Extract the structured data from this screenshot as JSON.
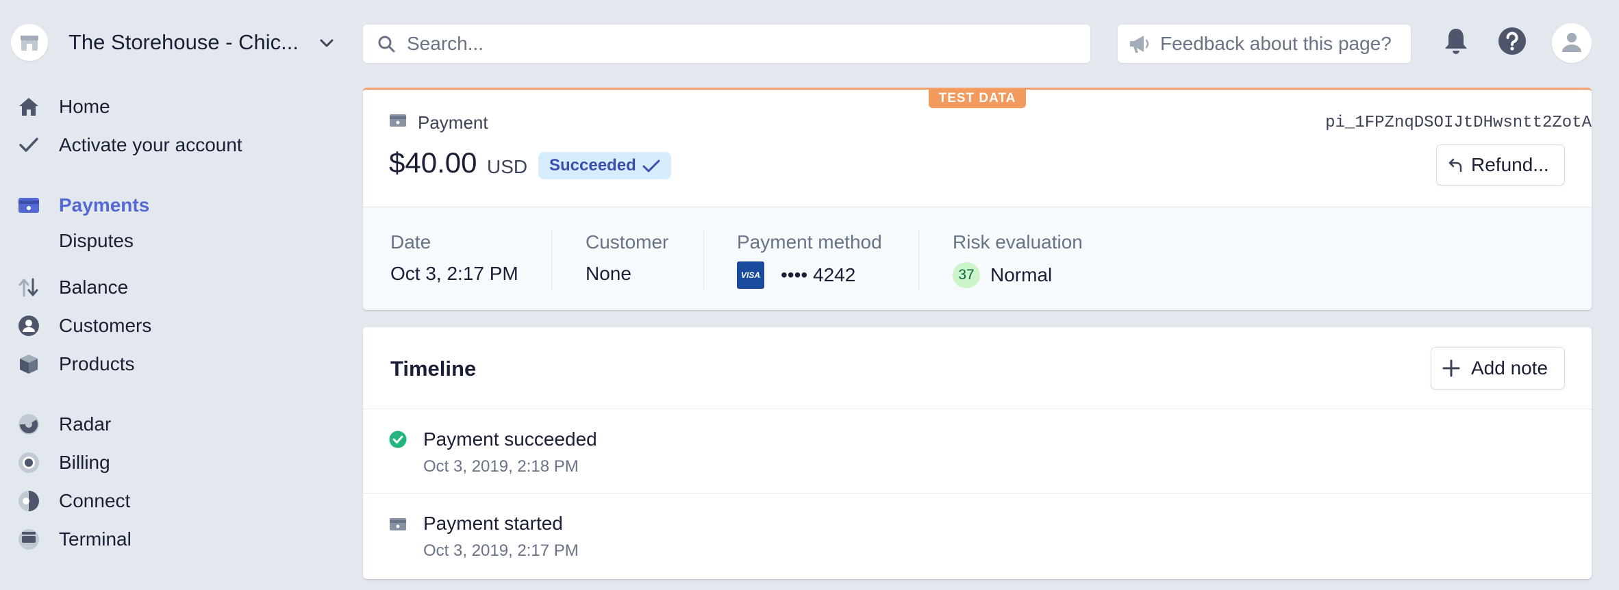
{
  "account": {
    "name": "The Storehouse - Chic..."
  },
  "search": {
    "placeholder": "Search..."
  },
  "feedback": {
    "label": "Feedback about this page?"
  },
  "sidebar": {
    "items": [
      {
        "label": "Home",
        "icon": "home-icon"
      },
      {
        "label": "Activate your account",
        "icon": "check-icon"
      },
      {
        "label": "Payments",
        "icon": "payments-icon",
        "active": true
      },
      {
        "label": "Disputes"
      },
      {
        "label": "Balance",
        "icon": "balance-icon"
      },
      {
        "label": "Customers",
        "icon": "customers-icon"
      },
      {
        "label": "Products",
        "icon": "products-icon"
      },
      {
        "label": "Radar",
        "icon": "radar-icon"
      },
      {
        "label": "Billing",
        "icon": "billing-icon"
      },
      {
        "label": "Connect",
        "icon": "connect-icon"
      },
      {
        "label": "Terminal",
        "icon": "terminal-icon"
      }
    ]
  },
  "payment": {
    "test_badge": "TEST DATA",
    "kind_label": "Payment",
    "id": "pi_1FPZnqDSOIJtDHwsntt2ZotA",
    "amount": "$40.00",
    "currency": "USD",
    "status": "Succeeded",
    "refund_label": "Refund...",
    "summary": {
      "date_label": "Date",
      "date_value": "Oct 3, 2:17 PM",
      "customer_label": "Customer",
      "customer_value": "None",
      "method_label": "Payment method",
      "card_brand": "VISA",
      "card_last4": "•••• 4242",
      "risk_label": "Risk evaluation",
      "risk_score": "37",
      "risk_value": "Normal"
    }
  },
  "timeline": {
    "title": "Timeline",
    "add_note_label": "Add note",
    "events": [
      {
        "title": "Payment succeeded",
        "time": "Oct 3, 2019, 2:18 PM",
        "icon": "check-circle-icon"
      },
      {
        "title": "Payment started",
        "time": "Oct 3, 2019, 2:17 PM",
        "icon": "payment-icon"
      }
    ]
  },
  "colors": {
    "accent": "#5469d4",
    "background": "#e3e8ee",
    "test_badge": "#f39a5f",
    "success_badge_bg": "#d6ecff",
    "success_green": "#24b47e",
    "risk_badge_bg": "#cbf4c9"
  }
}
